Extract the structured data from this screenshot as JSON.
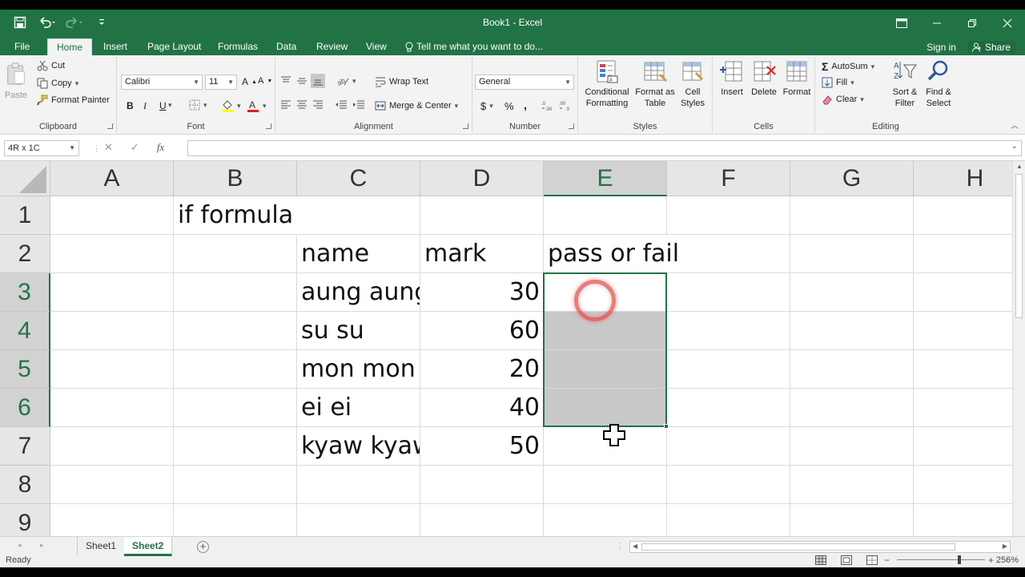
{
  "window": {
    "title": "Book1 - Excel"
  },
  "qat": {
    "save_icon": "save-icon",
    "undo_icon": "undo-icon",
    "redo_icon": "redo-icon"
  },
  "tabs": [
    "File",
    "Home",
    "Insert",
    "Page Layout",
    "Formulas",
    "Data",
    "Review",
    "View"
  ],
  "active_tab": "Home",
  "tellme": "Tell me what you want to do...",
  "signin": "Sign in",
  "share": "Share",
  "ribbon": {
    "clipboard": {
      "label": "Clipboard",
      "paste": "Paste",
      "cut": "Cut",
      "copy": "Copy",
      "format_painter": "Format Painter"
    },
    "font": {
      "label": "Font",
      "name": "Calibri",
      "size": "11",
      "bold": "B",
      "italic": "I",
      "underline": "U"
    },
    "alignment": {
      "label": "Alignment",
      "wrap_text": "Wrap Text",
      "merge_center": "Merge & Center"
    },
    "number": {
      "label": "Number",
      "format": "General",
      "currency": "$",
      "percent": "%",
      "comma": ","
    },
    "styles": {
      "label": "Styles",
      "conditional": "Conditional Formatting",
      "format_table": "Format as Table",
      "cell_styles": "Cell Styles"
    },
    "cells": {
      "label": "Cells",
      "insert": "Insert",
      "delete": "Delete",
      "format": "Format"
    },
    "editing": {
      "label": "Editing",
      "autosum": "AutoSum",
      "fill": "Fill",
      "clear": "Clear",
      "sort_filter": "Sort & Filter",
      "find_select": "Find & Select"
    }
  },
  "formula_bar": {
    "name_box": "4R x 1C",
    "cancel": "✕",
    "enter": "✓",
    "fx": "fx",
    "formula": ""
  },
  "columns": [
    "A",
    "B",
    "C",
    "D",
    "E",
    "F",
    "G",
    "H"
  ],
  "selected_column": "E",
  "rows": [
    "1",
    "2",
    "3",
    "4",
    "5",
    "6",
    "7",
    "8",
    "9"
  ],
  "selected_rows": [
    "3",
    "4",
    "5",
    "6"
  ],
  "cells": {
    "B1": "if formula",
    "C2": "name",
    "D2": "mark",
    "E2": "pass or fail",
    "C3": "aung aung",
    "D3": "30",
    "C4": "su su",
    "D4": "60",
    "C5": "mon mon",
    "D5": "20",
    "C6": "ei ei",
    "D6": "40",
    "C7": "kyaw kyaw",
    "D7": "50"
  },
  "sheets": [
    "Sheet1",
    "Sheet2"
  ],
  "active_sheet": "Sheet2",
  "status": {
    "ready": "Ready",
    "zoom": "256%"
  },
  "colors": {
    "accent": "#217346",
    "selection_shade": "#c8c8c8",
    "click_ring": "#e65050"
  }
}
